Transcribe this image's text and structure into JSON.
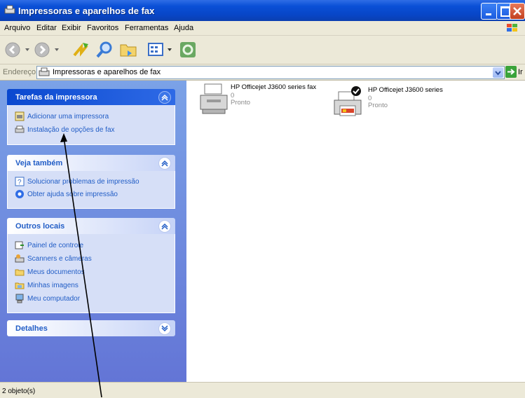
{
  "window": {
    "title": "Impressoras e aparelhos de fax"
  },
  "menu": [
    "Arquivo",
    "Editar",
    "Exibir",
    "Favoritos",
    "Ferramentas",
    "Ajuda"
  ],
  "address": {
    "label": "Endereço",
    "value": "Impressoras e aparelhos de fax",
    "go": "Ir"
  },
  "panels": {
    "printer_tasks": {
      "title": "Tarefas da impressora",
      "links": [
        "Adicionar uma impressora",
        "Instalação de opções de fax"
      ]
    },
    "see_also": {
      "title": "Veja também",
      "links": [
        "Solucionar problemas de impressão",
        "Obter ajuda sobre impressão"
      ]
    },
    "other_places": {
      "title": "Outros locais",
      "links": [
        "Painel de controle",
        "Scanners e câmeras",
        "Meus documentos",
        "Minhas imagens",
        "Meu computador"
      ]
    },
    "details": {
      "title": "Detalhes"
    }
  },
  "items": [
    {
      "name": "HP Officejet J3600 series fax",
      "count": "0",
      "status": "Pronto"
    },
    {
      "name": "HP Officejet J3600 series",
      "count": "0",
      "status": "Pronto"
    }
  ],
  "status": {
    "text": "2 objeto(s)"
  },
  "colors": {
    "titlebar": "#0a4fd6",
    "taskpane": "#7ba2e7",
    "link": "#215dc6"
  }
}
